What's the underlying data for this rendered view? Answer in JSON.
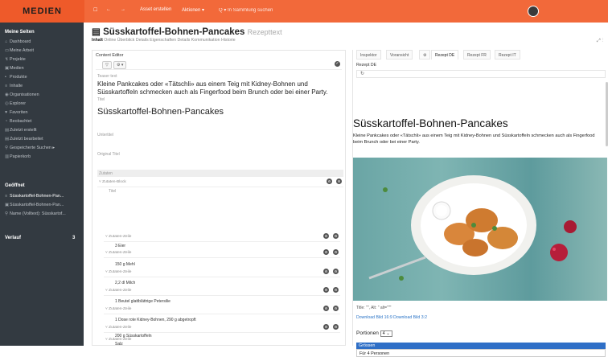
{
  "topbar": {
    "logo": "MEDIEN",
    "create_asset": "Asset erstellen",
    "actions": "Aktionen ▾",
    "search": "Q ▾  In Sammlung suchen"
  },
  "sidebar": {
    "section1": "Meine Seiten",
    "items": [
      "Dashboard",
      "Meine Arbeit",
      "Projekte",
      "Medien",
      "Produkte",
      "Inhalte",
      "Organisationen",
      "Explorer",
      "Favoriten",
      "Beobachtet",
      "Zuletzt erstellt",
      "Zuletzt bearbeitet",
      "Gespeicherte Suchen ▸",
      "Papierkorb"
    ],
    "section2": "Geöffnet",
    "open_items": [
      "Süsskartoffel-Bohnen-Pan...",
      "Süsskartoffel-Bohnen-Pan...",
      "Name (Volltext): Süsskartof..."
    ],
    "section3": "Verlauf",
    "history_count": "3"
  },
  "main": {
    "title": "Süsskartoffel-Bohnen-Pancakes",
    "title_sub": "Rezepttext",
    "tabs": [
      "Inhalt",
      "Online",
      "Überblick",
      "Details",
      "Eigenschaften",
      "Details",
      "Kommunikation",
      "Historie"
    ]
  },
  "editor": {
    "heading": "Content Editor",
    "teaser_label": "Teaser text",
    "teaser": "Kleine Pankcakes oder «Tätschli» aus einem Teig mit Kidney-Bohnen und Süsskartoffeln schmecken auch als Fingerfood beim Brunch oder bei einer Party.",
    "title_label": "Titel",
    "title": "Süsskartoffel-Bohnen-Pancakes",
    "subtitle_label": "Untertitel",
    "orig_label": "Original Titel",
    "ingredients_label": "Zutaten",
    "block_label": "Zutaten-Block",
    "block_title_label": "Titel",
    "row_label": "Zutaten-Zeile",
    "ingredients": [
      "3 Eier",
      "150 g Mehl",
      "2,2 dl Milch",
      "1 Beutel glattblättrige Petersilie",
      "1 Dose rote Kidney-Bohnen, 290 g abgetropft",
      "200 g Süsskartoffeln",
      "Salz"
    ]
  },
  "preview": {
    "tabs": [
      "Inspektor",
      "Voransicht",
      "⚙",
      "Rezept DE",
      "Rezept FR",
      "Rezept IT"
    ],
    "active_tab": "Rezept DE",
    "section": "Rezept DE",
    "title": "Süsskartoffel-Bohnen-Pancakes",
    "teaser": "Kleine Pankcakes oder «Tätschli» aus einem Teig mit Kidney-Bohnen und Süsskartoffeln schmecken auch als Fingerfood beim Brunch oder bei einer Party.",
    "caption": "Title: \"\", Alt: \" alt=\"\"\"",
    "links": "Download Bild 16:9 Download Bild 3:2",
    "portions_label": "Portionen",
    "portions_value": "4",
    "dropdown_header": "Grössen",
    "dropdown_option": "Für 4 Personen"
  }
}
